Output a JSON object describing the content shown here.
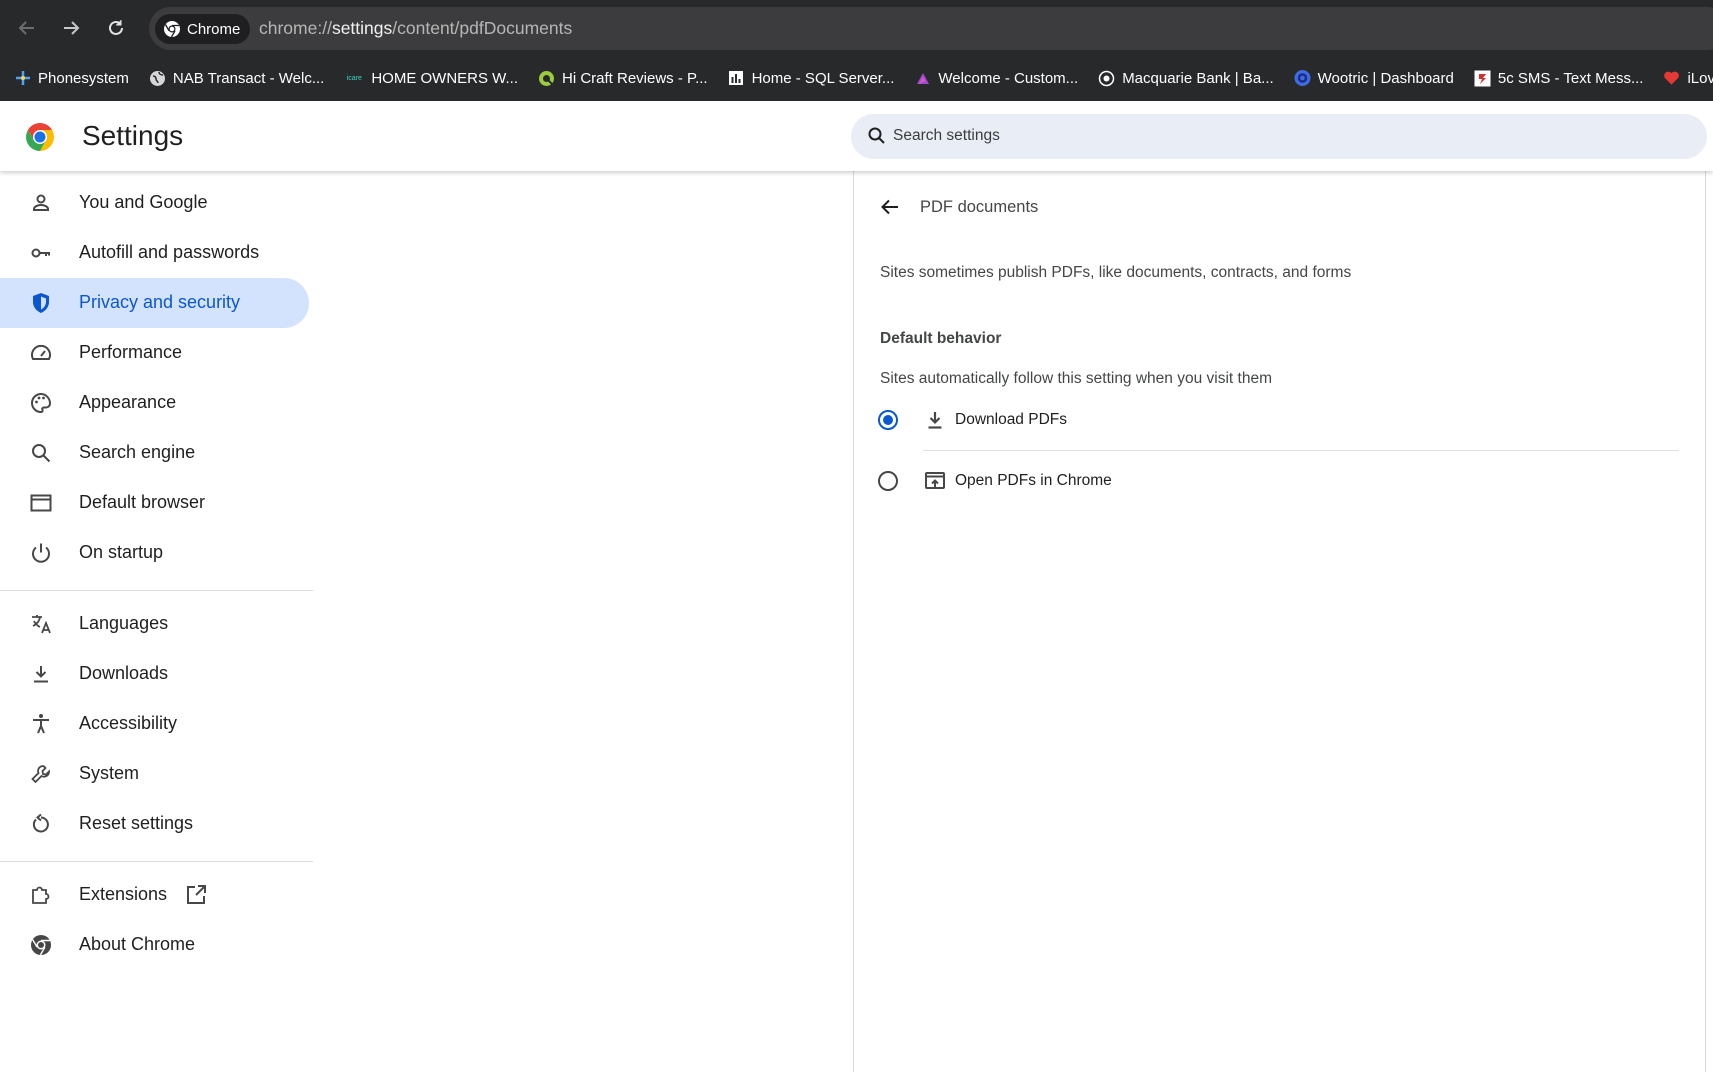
{
  "browser": {
    "chip_label": "Chrome",
    "url_scheme": "chrome://",
    "url_host": "settings",
    "url_path": "/content/pdfDocuments",
    "bookmarks": [
      {
        "label": "Phonesystem",
        "icon": "phonesystem-icon"
      },
      {
        "label": "NAB Transact - Welc...",
        "icon": "globe-icon"
      },
      {
        "label": "HOME OWNERS W...",
        "icon": "icare-logo-icon",
        "icon_text": "icare"
      },
      {
        "label": "Hi Craft Reviews - P...",
        "icon": "reviews-q-icon"
      },
      {
        "label": "Home - SQL Server...",
        "icon": "bar-chart-icon"
      },
      {
        "label": "Welcome - Custom...",
        "icon": "customer-portal-icon"
      },
      {
        "label": "Macquarie Bank | Ba...",
        "icon": "target-icon"
      },
      {
        "label": "Wootric | Dashboard",
        "icon": "wootric-icon"
      },
      {
        "label": "5c SMS - Text Mess...",
        "icon": "sms-icon"
      },
      {
        "label": "iLove",
        "icon": "heart-icon"
      }
    ]
  },
  "header": {
    "title": "Settings",
    "search_placeholder": "Search settings"
  },
  "sidebar": {
    "items": [
      {
        "label": "You and Google",
        "icon": "person-icon"
      },
      {
        "label": "Autofill and passwords",
        "icon": "key-icon"
      },
      {
        "label": "Privacy and security",
        "icon": "shield-icon",
        "active": true
      },
      {
        "label": "Performance",
        "icon": "speedometer-icon"
      },
      {
        "label": "Appearance",
        "icon": "palette-icon"
      },
      {
        "label": "Search engine",
        "icon": "search-icon"
      },
      {
        "label": "Default browser",
        "icon": "browser-window-icon"
      },
      {
        "label": "On startup",
        "icon": "power-icon"
      },
      {
        "label": "Languages",
        "icon": "translate-icon"
      },
      {
        "label": "Downloads",
        "icon": "download-icon"
      },
      {
        "label": "Accessibility",
        "icon": "accessibility-icon"
      },
      {
        "label": "System",
        "icon": "wrench-icon"
      },
      {
        "label": "Reset settings",
        "icon": "reset-icon"
      },
      {
        "label": "Extensions",
        "icon": "puzzle-icon"
      },
      {
        "label": "About Chrome",
        "icon": "chrome-icon"
      }
    ]
  },
  "main": {
    "title": "PDF documents",
    "description": "Sites sometimes publish PDFs, like documents, contracts, and forms",
    "section_title": "Default behavior",
    "section_subtitle": "Sites automatically follow this setting when you visit them",
    "options": [
      {
        "label": "Download PDFs",
        "icon": "download-icon",
        "selected": true
      },
      {
        "label": "Open PDFs in Chrome",
        "icon": "open-in-browser-icon",
        "selected": false
      }
    ]
  },
  "colors": {
    "accent": "#0b57d0",
    "active_bg": "#d3e3fd",
    "toolbar_bg": "#28292b"
  }
}
